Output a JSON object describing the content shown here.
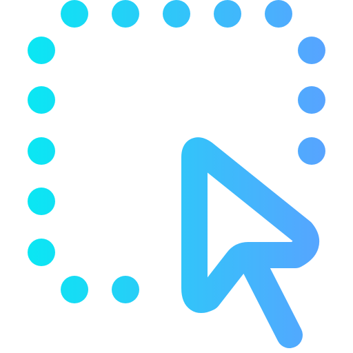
{
  "icon": {
    "name": "selection-cursor-icon",
    "gradient": {
      "start": "#0AE7F3",
      "end": "#57A4FF"
    },
    "parts": [
      "dotted-selection-frame",
      "arrow-cursor"
    ]
  }
}
